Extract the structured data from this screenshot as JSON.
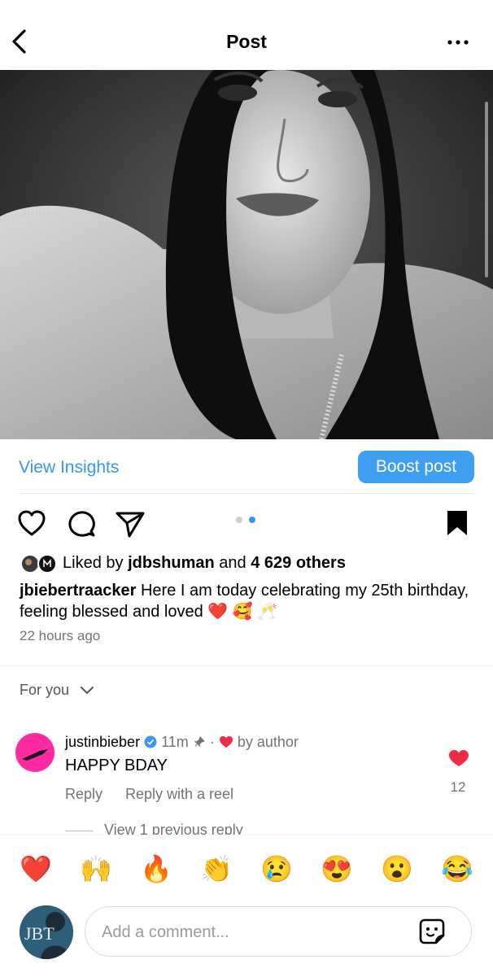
{
  "header": {
    "title": "Post"
  },
  "actions": {
    "view_insights": "View Insights",
    "boost_post": "Boost post"
  },
  "carousel": {
    "count": 2,
    "active_index": 1
  },
  "likes": {
    "prefix": "Liked by ",
    "user": "jdbshuman",
    "middle": " and ",
    "others": "4 629 others"
  },
  "caption": {
    "user": "jbiebertraacker",
    "text": " Here I am today celebrating my 25th birthday, feeling blessed and loved ❤️ 🥰 🥂"
  },
  "time_ago": "22 hours ago",
  "filter": {
    "label": "For you"
  },
  "comment": {
    "user": "justinbieber",
    "time": "11m",
    "by_author": "by author",
    "text": "HAPPY BDAY",
    "reply": "Reply",
    "reply_reel": "Reply with a reel",
    "likes": "12",
    "view_previous": "View 1 previous reply"
  },
  "quick_reactions": [
    {
      "name": "heart",
      "glyph": "❤️"
    },
    {
      "name": "raised-hands",
      "glyph": "🙌"
    },
    {
      "name": "fire",
      "glyph": "🔥"
    },
    {
      "name": "clapping",
      "glyph": "👏"
    },
    {
      "name": "crying",
      "glyph": "😢"
    },
    {
      "name": "heart-eyes",
      "glyph": "😍"
    },
    {
      "name": "surprised",
      "glyph": "😮"
    },
    {
      "name": "laughing",
      "glyph": "😂"
    }
  ],
  "composer": {
    "placeholder": "Add a comment...",
    "avatar_text": "JBT"
  },
  "colors": {
    "accent": "#3797f0",
    "heart_red": "#ed2d43",
    "bookmark": "#000000",
    "comment_avatar_bg": "#ff2aa1"
  }
}
